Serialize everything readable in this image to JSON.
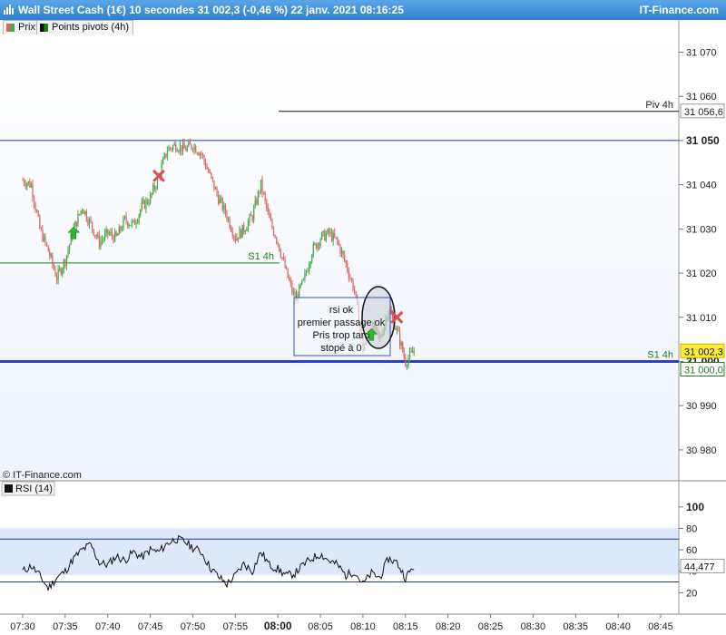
{
  "header": {
    "title": "Wall Street Cash (1€) 10 secondes 31 002,3 (-0,46 %) 22 janv. 2021 08:16:25",
    "brand": "IT-Finance.com"
  },
  "legend": {
    "price": "Prix",
    "pivots": "Points pivots (4h)",
    "rsi": "RSI (14)"
  },
  "watermark": "© IT-Finance.com",
  "colors": {
    "up": "#3fae3f",
    "down": "#e06666",
    "pivot_blue": "#2233aa",
    "support_green": "#1e7d1e",
    "rsi_bg": "#dde8fb"
  },
  "chart_data": [
    {
      "type": "candlestick",
      "title": "Wall Street Cash (1€) 10 secondes",
      "last_price": "31 002,3",
      "change": "(-0,46 %)",
      "date": "22 janv. 2021 08:16:25",
      "x_ticks": [
        "07:30",
        "07:35",
        "07:40",
        "07:45",
        "07:50",
        "07:55",
        "08:00",
        "08:05",
        "08:10",
        "08:15",
        "08:20",
        "08:25",
        "08:30",
        "08:35",
        "08:40",
        "08:45"
      ],
      "y_ticks": [
        "31 070",
        "31 060",
        "31 050",
        "31 040",
        "31 030",
        "31 020",
        "31 010",
        "31 000",
        "30 990",
        "30 980"
      ],
      "ylim": [
        30973,
        31074
      ],
      "levels": [
        {
          "name": "Piv 4h",
          "value": 31056.6,
          "label": "31 056,6"
        },
        {
          "name": "",
          "value": 31050.0,
          "label": "31 050"
        },
        {
          "name": "S1 4h",
          "value": 31022.3,
          "label": "S1 4h"
        },
        {
          "name": "S1 4h",
          "value": 31000.0,
          "label": "31 000,0"
        }
      ],
      "current_label": "31 002,3",
      "annotation": {
        "lines": [
          "rsi ok",
          "premier passage ok",
          "Pris trop tard",
          "stopé à 0"
        ]
      },
      "close_path": [
        [
          "07:30",
          31041
        ],
        [
          "07:31",
          31040
        ],
        [
          "07:32",
          31030
        ],
        [
          "07:33",
          31025
        ],
        [
          "07:34",
          31019
        ],
        [
          "07:35",
          31023
        ],
        [
          "07:36",
          31030
        ],
        [
          "07:37",
          31035
        ],
        [
          "07:38",
          31031
        ],
        [
          "07:39",
          31027
        ],
        [
          "07:40",
          31029
        ],
        [
          "07:41",
          31028
        ],
        [
          "07:42",
          31032
        ],
        [
          "07:43",
          31031
        ],
        [
          "07:44",
          31035
        ],
        [
          "07:45",
          31037
        ],
        [
          "07:46",
          31042
        ],
        [
          "07:47",
          31048
        ],
        [
          "07:48",
          31049
        ],
        [
          "07:49",
          31048
        ],
        [
          "07:50",
          31049
        ],
        [
          "07:51",
          31047
        ],
        [
          "07:52",
          31042
        ],
        [
          "07:53",
          31037
        ],
        [
          "07:54",
          31033
        ],
        [
          "07:55",
          31028
        ],
        [
          "07:56",
          31030
        ],
        [
          "07:57",
          31033
        ],
        [
          "07:58",
          31040
        ],
        [
          "07:59",
          31032
        ],
        [
          "08:00",
          31027
        ],
        [
          "08:01",
          31020
        ],
        [
          "08:02",
          31014
        ],
        [
          "08:03",
          31018
        ],
        [
          "08:04",
          31025
        ],
        [
          "08:05",
          31028
        ],
        [
          "08:06",
          31029
        ],
        [
          "08:07",
          31027
        ],
        [
          "08:08",
          31022
        ],
        [
          "08:09",
          31016
        ],
        [
          "08:10",
          31003
        ],
        [
          "08:11",
          31008
        ],
        [
          "08:12",
          31005
        ],
        [
          "08:13",
          31012
        ],
        [
          "08:14",
          31007
        ],
        [
          "08:15",
          31000
        ],
        [
          "08:16",
          31002.3
        ]
      ],
      "signals": [
        {
          "type": "buy",
          "time": "07:36",
          "price": 31029
        },
        {
          "type": "sell",
          "time": "07:46",
          "price": 31042
        },
        {
          "type": "buy",
          "time": "08:11",
          "price": 31006
        },
        {
          "type": "sell",
          "time": "08:14",
          "price": 31010
        }
      ]
    },
    {
      "type": "line",
      "title": "RSI (14)",
      "y_ticks": [
        "100",
        "80",
        "60",
        "40",
        "20"
      ],
      "ylim": [
        0,
        110
      ],
      "levels": [
        70,
        30
      ],
      "current_label": "44,477",
      "series": [
        {
          "name": "RSI (14)",
          "points": [
            [
              "07:30",
              40
            ],
            [
              "07:31",
              45
            ],
            [
              "07:32",
              36
            ],
            [
              "07:33",
              24
            ],
            [
              "07:34",
              34
            ],
            [
              "07:35",
              40
            ],
            [
              "07:36",
              52
            ],
            [
              "07:37",
              60
            ],
            [
              "07:38",
              65
            ],
            [
              "07:39",
              48
            ],
            [
              "07:40",
              46
            ],
            [
              "07:41",
              54
            ],
            [
              "07:42",
              50
            ],
            [
              "07:43",
              58
            ],
            [
              "07:44",
              53
            ],
            [
              "07:45",
              60
            ],
            [
              "07:46",
              58
            ],
            [
              "07:47",
              66
            ],
            [
              "07:48",
              70
            ],
            [
              "07:49",
              68
            ],
            [
              "07:50",
              62
            ],
            [
              "07:51",
              58
            ],
            [
              "07:52",
              44
            ],
            [
              "07:53",
              35
            ],
            [
              "07:54",
              28
            ],
            [
              "07:55",
              36
            ],
            [
              "07:56",
              47
            ],
            [
              "07:57",
              40
            ],
            [
              "07:58",
              58
            ],
            [
              "07:59",
              46
            ],
            [
              "08:00",
              42
            ],
            [
              "08:01",
              36
            ],
            [
              "08:02",
              38
            ],
            [
              "08:03",
              46
            ],
            [
              "08:04",
              52
            ],
            [
              "08:05",
              56
            ],
            [
              "08:06",
              50
            ],
            [
              "08:07",
              46
            ],
            [
              "08:08",
              36
            ],
            [
              "08:09",
              40
            ],
            [
              "08:10",
              28
            ],
            [
              "08:11",
              38
            ],
            [
              "08:12",
              34
            ],
            [
              "08:13",
              52
            ],
            [
              "08:14",
              48
            ],
            [
              "08:15",
              34
            ],
            [
              "08:16",
              44.477
            ]
          ]
        }
      ]
    }
  ]
}
